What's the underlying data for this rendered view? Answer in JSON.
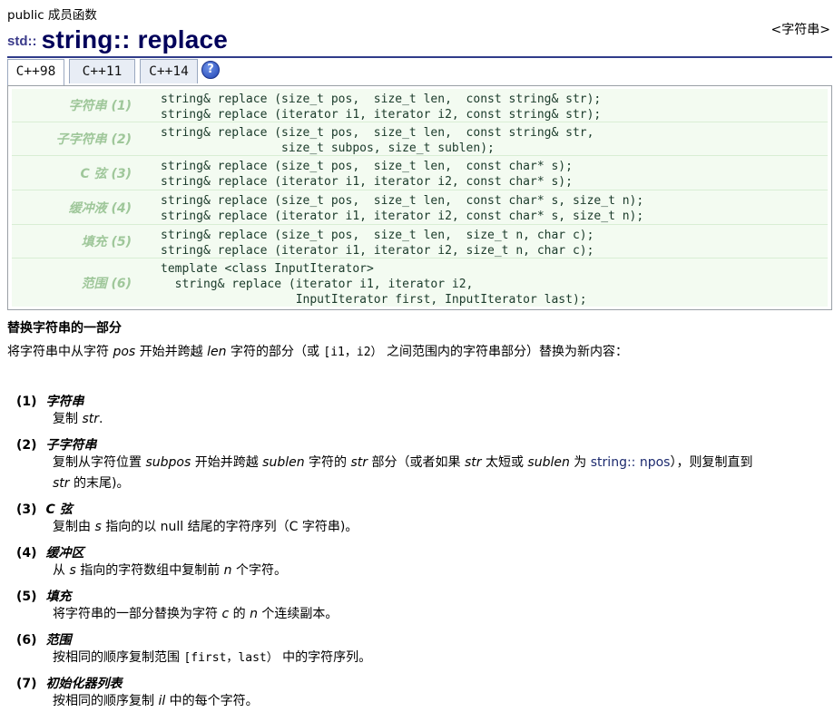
{
  "breadcrumb": "public 成员函数",
  "header_link": "<字符串>",
  "title": {
    "ns": "std::",
    "name": "string",
    "sep": ":: ",
    "member": "replace"
  },
  "tabs": [
    "C++98",
    "C++11",
    "C++14"
  ],
  "help_icon_label": "?",
  "declarations": [
    {
      "label": "字符串 (1)",
      "lines": [
        "string& replace (size_t pos,  size_t len,  const string& str);",
        "string& replace (iterator i1, iterator i2, const string& str);"
      ]
    },
    {
      "label": "子字符串 (2)",
      "lines": [
        "string& replace (size_t pos,  size_t len,  const string& str,",
        "                 size_t subpos, size_t sublen);"
      ]
    },
    {
      "label": "C 弦 (3)",
      "lines": [
        "string& replace (size_t pos,  size_t len,  const char* s);",
        "string& replace (iterator i1, iterator i2, const char* s);"
      ]
    },
    {
      "label": "缓冲液 (4)",
      "lines": [
        "string& replace (size_t pos,  size_t len,  const char* s, size_t n);",
        "string& replace (iterator i1, iterator i2, const char* s, size_t n);"
      ]
    },
    {
      "label": "填充 (5)",
      "lines": [
        "string& replace (size_t pos,  size_t len,  size_t n, char c);",
        "string& replace (iterator i1, iterator i2, size_t n, char c);"
      ]
    },
    {
      "label": "范围 (6)",
      "lines": [
        "template <class InputIterator>",
        "  string& replace (iterator i1, iterator i2,",
        "                   InputIterator first, InputIterator last);"
      ]
    }
  ],
  "section_title": "替换字符串的一部分",
  "intro": {
    "p1": "将字符串中从字符 ",
    "pos": "pos",
    "p2": " 开始并跨越 ",
    "len": "len",
    "p3": " 字符的部分（或 ",
    "range": "[i1，i2）",
    "p4": " 之间范围内的字符串部分）替换为新内容："
  },
  "items": [
    {
      "num": "(1)",
      "name": "字符串",
      "d": {
        "a": "复制 ",
        "b": "str",
        "c": "."
      }
    },
    {
      "num": "(2)",
      "name": "子字符串",
      "d": {
        "a": "复制从字符位置 ",
        "subpos": "subpos",
        "b": " 开始并跨越 ",
        "sublen": "sublen",
        "c": " 字符的 ",
        "str": "str",
        "d2": " 部分（或者如果 ",
        "str2": "str",
        "e": " 太短或 ",
        "sublen2": "sublen",
        "f": " 为 ",
        "npos": "string:: npos",
        "g": "），则复制直到",
        "str3": "str",
        "h": " 的末尾)。"
      }
    },
    {
      "num": "(3)",
      "name": "C 弦",
      "d": {
        "a": "复制由 ",
        "s": "s",
        "b": " 指向的以 null 结尾的字符序列（C 字符串)。"
      }
    },
    {
      "num": "(4)",
      "name": "缓冲区",
      "d": {
        "a": "从 ",
        "s": "s",
        "b": " 指向的字符数组中复制前 ",
        "n": "n",
        "c": " 个字符。"
      }
    },
    {
      "num": "(5)",
      "name": "填充",
      "d": {
        "a": "将字符串的一部分替换为字符 ",
        "c": "c",
        "b": " 的 ",
        "n": "n",
        "e": " 个连续副本。"
      }
    },
    {
      "num": "(6)",
      "name": "范围",
      "d": {
        "a": "按相同的顺序复制范围 ",
        "range": "[first，last）",
        "b": " 中的字符序列。"
      }
    },
    {
      "num": "(7)",
      "name": "初始化器列表",
      "d": {
        "a": "按相同的顺序复制 ",
        "il": "il",
        "b": " 中的每个字符。"
      }
    }
  ]
}
